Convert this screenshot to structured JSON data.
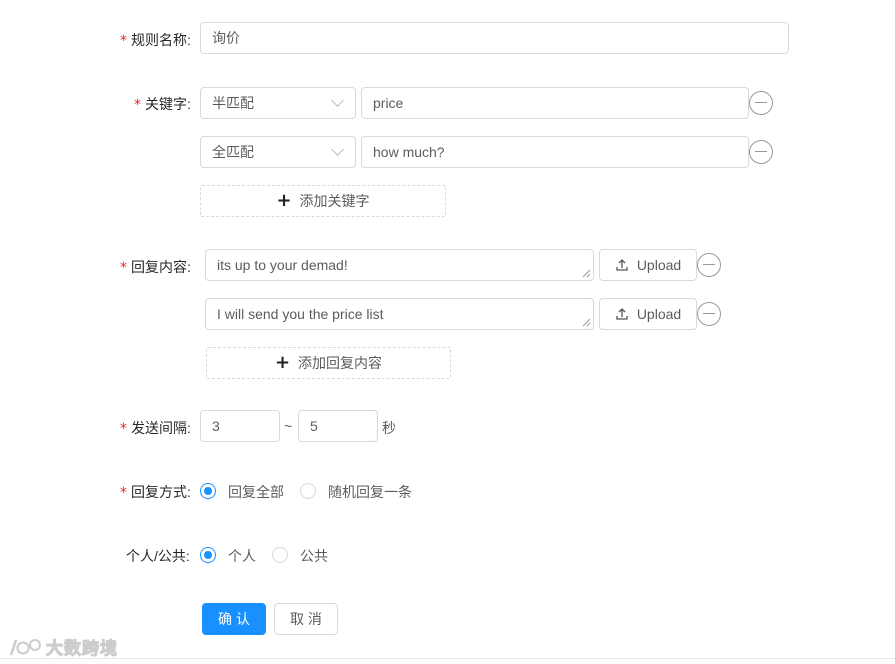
{
  "form": {
    "rule_name": {
      "required_mark": "*",
      "label": "规则名称:",
      "value": "询价"
    },
    "keywords": {
      "required_mark": "*",
      "label": "关键字:",
      "rows": [
        {
          "match": "半匹配",
          "value": "price"
        },
        {
          "match": "全匹配",
          "value": "how much?"
        }
      ],
      "add_label": "添加关键字",
      "add_icon": "plus-icon"
    },
    "reply": {
      "required_mark": "*",
      "label": "回复内容:",
      "rows": [
        {
          "value": "its up to your demad!",
          "upload_label": "Upload"
        },
        {
          "value": "I will send you the price list",
          "upload_label": "Upload"
        }
      ],
      "add_label": "添加回复内容",
      "add_icon": "plus-icon"
    },
    "interval": {
      "required_mark": "*",
      "label": "发送间隔:",
      "from": "3",
      "separator": "~",
      "to": "5",
      "unit": "秒"
    },
    "reply_mode": {
      "required_mark": "*",
      "label": "回复方式:",
      "options": [
        "回复全部",
        "随机回复一条"
      ],
      "selected": "回复全部"
    },
    "visibility": {
      "label": "个人/公共:",
      "options": [
        "个人",
        "公共"
      ],
      "selected": "个人"
    },
    "actions": {
      "confirm": "确 认",
      "cancel": "取 消"
    }
  },
  "watermark": {
    "text": "大数跨境"
  },
  "colors": {
    "primary": "#1890ff",
    "required": "#f5222d",
    "border": "#d9d9d9",
    "remove_icon": "#999999"
  }
}
